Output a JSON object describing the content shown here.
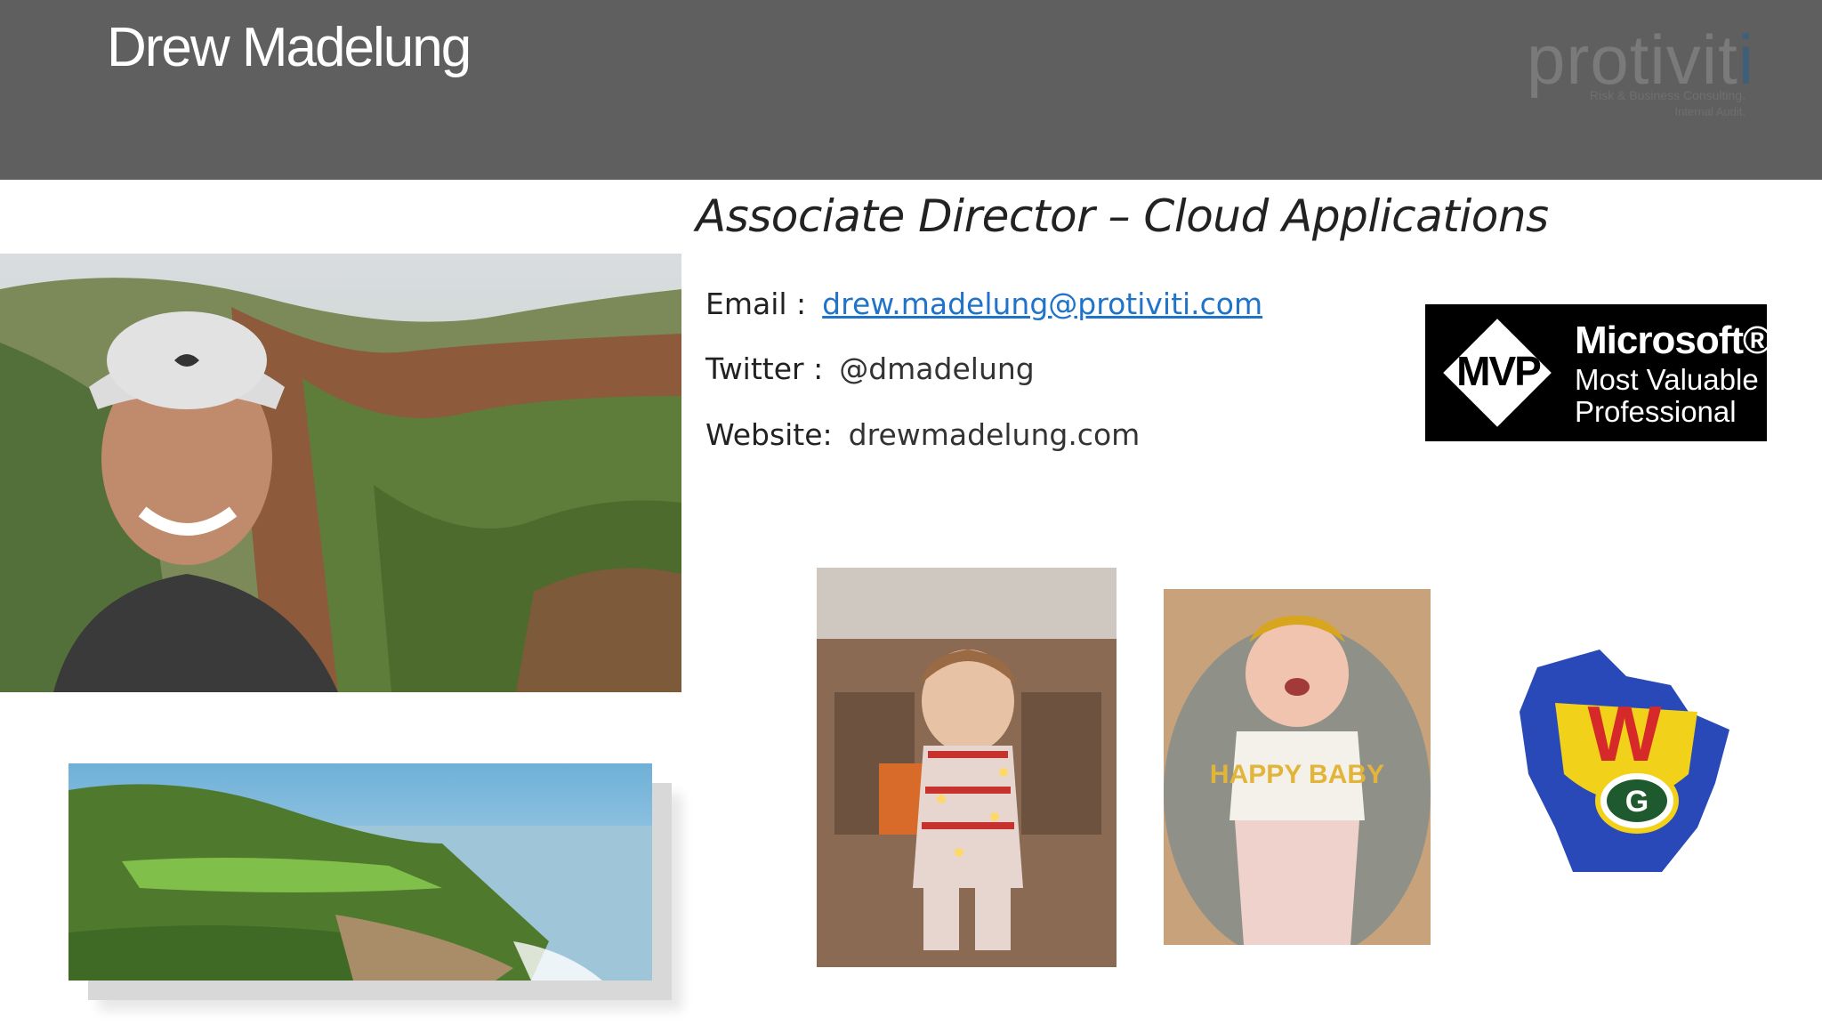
{
  "header": {
    "name": "Drew Madelung",
    "logo": {
      "word_part1": "protivit",
      "word_part2": "i",
      "tagline1": "Risk & Business Consulting.",
      "tagline2": "Internal Audit."
    }
  },
  "profile": {
    "job_title": "Associate Director – Cloud Applications",
    "email_label": "Email :",
    "email_value": "drew.madelung@protiviti.com",
    "twitter_label": "Twitter :",
    "twitter_value": "@dmadelung",
    "website_label": "Website:",
    "website_value": "drewmadelung.com"
  },
  "mvp_badge": {
    "mvp": "MVP",
    "line1": "Microsoft®",
    "line2": "Most Valuable",
    "line3": "Professional"
  },
  "photos": {
    "baby_shirt": "HAPPY BABY",
    "wisconsin_w": "W",
    "wisconsin_g": "G"
  },
  "colors": {
    "header_bg": "#5f5f5f",
    "link": "#1f73c9"
  }
}
